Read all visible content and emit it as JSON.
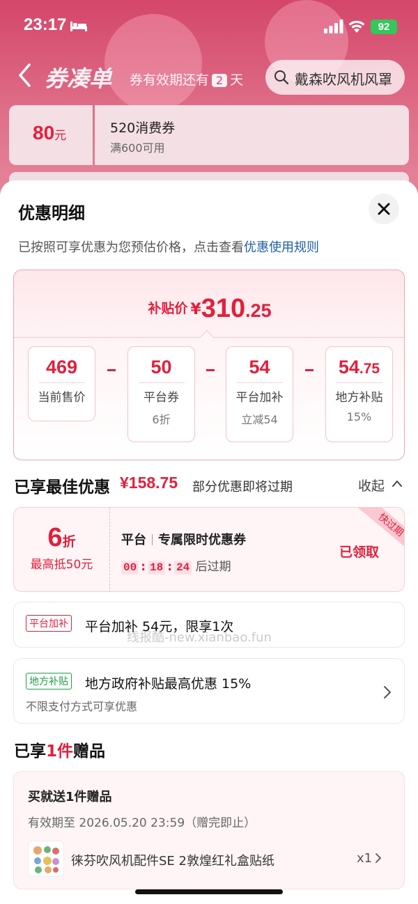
{
  "status_bar": {
    "time": "23:17",
    "battery": "92"
  },
  "nav": {
    "title": "券凑单",
    "validity_prefix": "券有效期还有",
    "validity_days": "2",
    "validity_suffix": "天",
    "search_placeholder": "戴森吹风机风罩"
  },
  "background_coupon": {
    "amount": "80",
    "amount_unit": "元",
    "name": "520消费券",
    "condition": "满600可用"
  },
  "sheet": {
    "title": "优惠明细",
    "desc_text": "已按照可享优惠为您预估价格，点击查看",
    "desc_link": "优惠使用规则"
  },
  "price": {
    "label": "补贴价",
    "currency": "¥",
    "integer": "310",
    "decimal": ".25",
    "components": [
      {
        "value": "469",
        "label": "当前售价",
        "sub": ""
      },
      {
        "value": "50",
        "label": "平台券",
        "sub": "6折"
      },
      {
        "value": "54",
        "label": "平台加补",
        "sub": "立减54"
      },
      {
        "value_int": "54",
        "value_dec": ".75",
        "label": "地方补贴",
        "sub": "15%"
      }
    ]
  },
  "best": {
    "title": "已享最佳优惠",
    "amount": "¥158.75",
    "note": "部分优惠即将过期",
    "collapse_label": "收起"
  },
  "coupon": {
    "discount": "6",
    "discount_unit": "折",
    "max": "最高抵50元",
    "source": "平台",
    "name": "专属限时优惠券",
    "countdown": [
      "00",
      "18",
      "24"
    ],
    "countdown_suffix": "后过期",
    "status": "已领取",
    "ribbon": "快过期"
  },
  "perks": [
    {
      "tag": "平台加补",
      "text": "平台加补 54元，限享1次",
      "sub": ""
    },
    {
      "tag": "地方补贴",
      "text": "地方政府补贴最高优惠 15%",
      "sub": "不限支付方式可享优惠"
    }
  ],
  "watermark": "线报酷-new.xianbao.fun",
  "gift": {
    "title_prefix": "已享",
    "title_count": "1件",
    "title_suffix": "赠品",
    "head": "买就送1件赠品",
    "valid": "有效期至 2026.05.20 23:59（赠完即止）",
    "item_name": "徕芬吹风机配件SE 2敦煌红礼盒贴纸",
    "item_qty": "x1"
  },
  "colors": {
    "accent": "#e1203c",
    "link": "#1e5fa8",
    "green_tag": "#1a9e45"
  }
}
